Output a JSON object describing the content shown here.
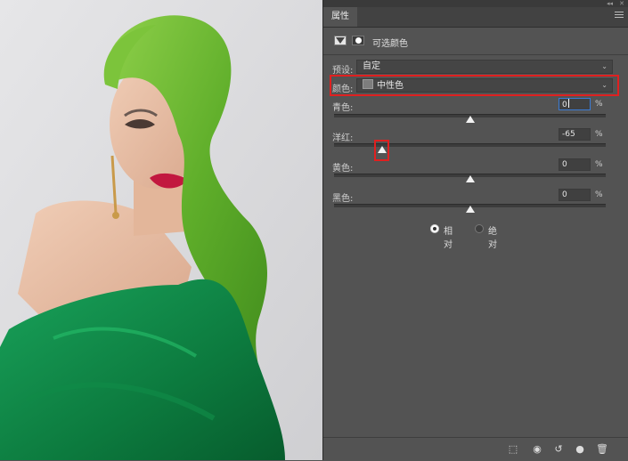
{
  "panel": {
    "tab_label": "属性",
    "header_title": "可选颜色",
    "preset": {
      "label": "预设:",
      "value": "自定"
    },
    "colors": {
      "label": "颜色:",
      "value": "中性色"
    },
    "sliders": [
      {
        "label": "青色:",
        "value": "0",
        "unit": "%",
        "level": 0
      },
      {
        "label": "洋红:",
        "value": "-65",
        "unit": "%",
        "level": -65
      },
      {
        "label": "黄色:",
        "value": "0",
        "unit": "%",
        "level": 0
      },
      {
        "label": "黑色:",
        "value": "0",
        "unit": "%",
        "level": 0
      }
    ],
    "method": {
      "relative_label": "相对",
      "absolute_label": "绝对",
      "selected": "relative"
    }
  },
  "colors": {
    "panel_bg": "#535353",
    "highlight": "#e02020",
    "accent": "#3b7bd4"
  },
  "icons": [
    "collapse-icon",
    "close-icon",
    "panel-menu-icon",
    "adjustment-icon",
    "mask-icon",
    "clip-to-layer-icon",
    "view-previous-icon",
    "reset-icon",
    "visibility-eye-icon",
    "trash-icon"
  ]
}
